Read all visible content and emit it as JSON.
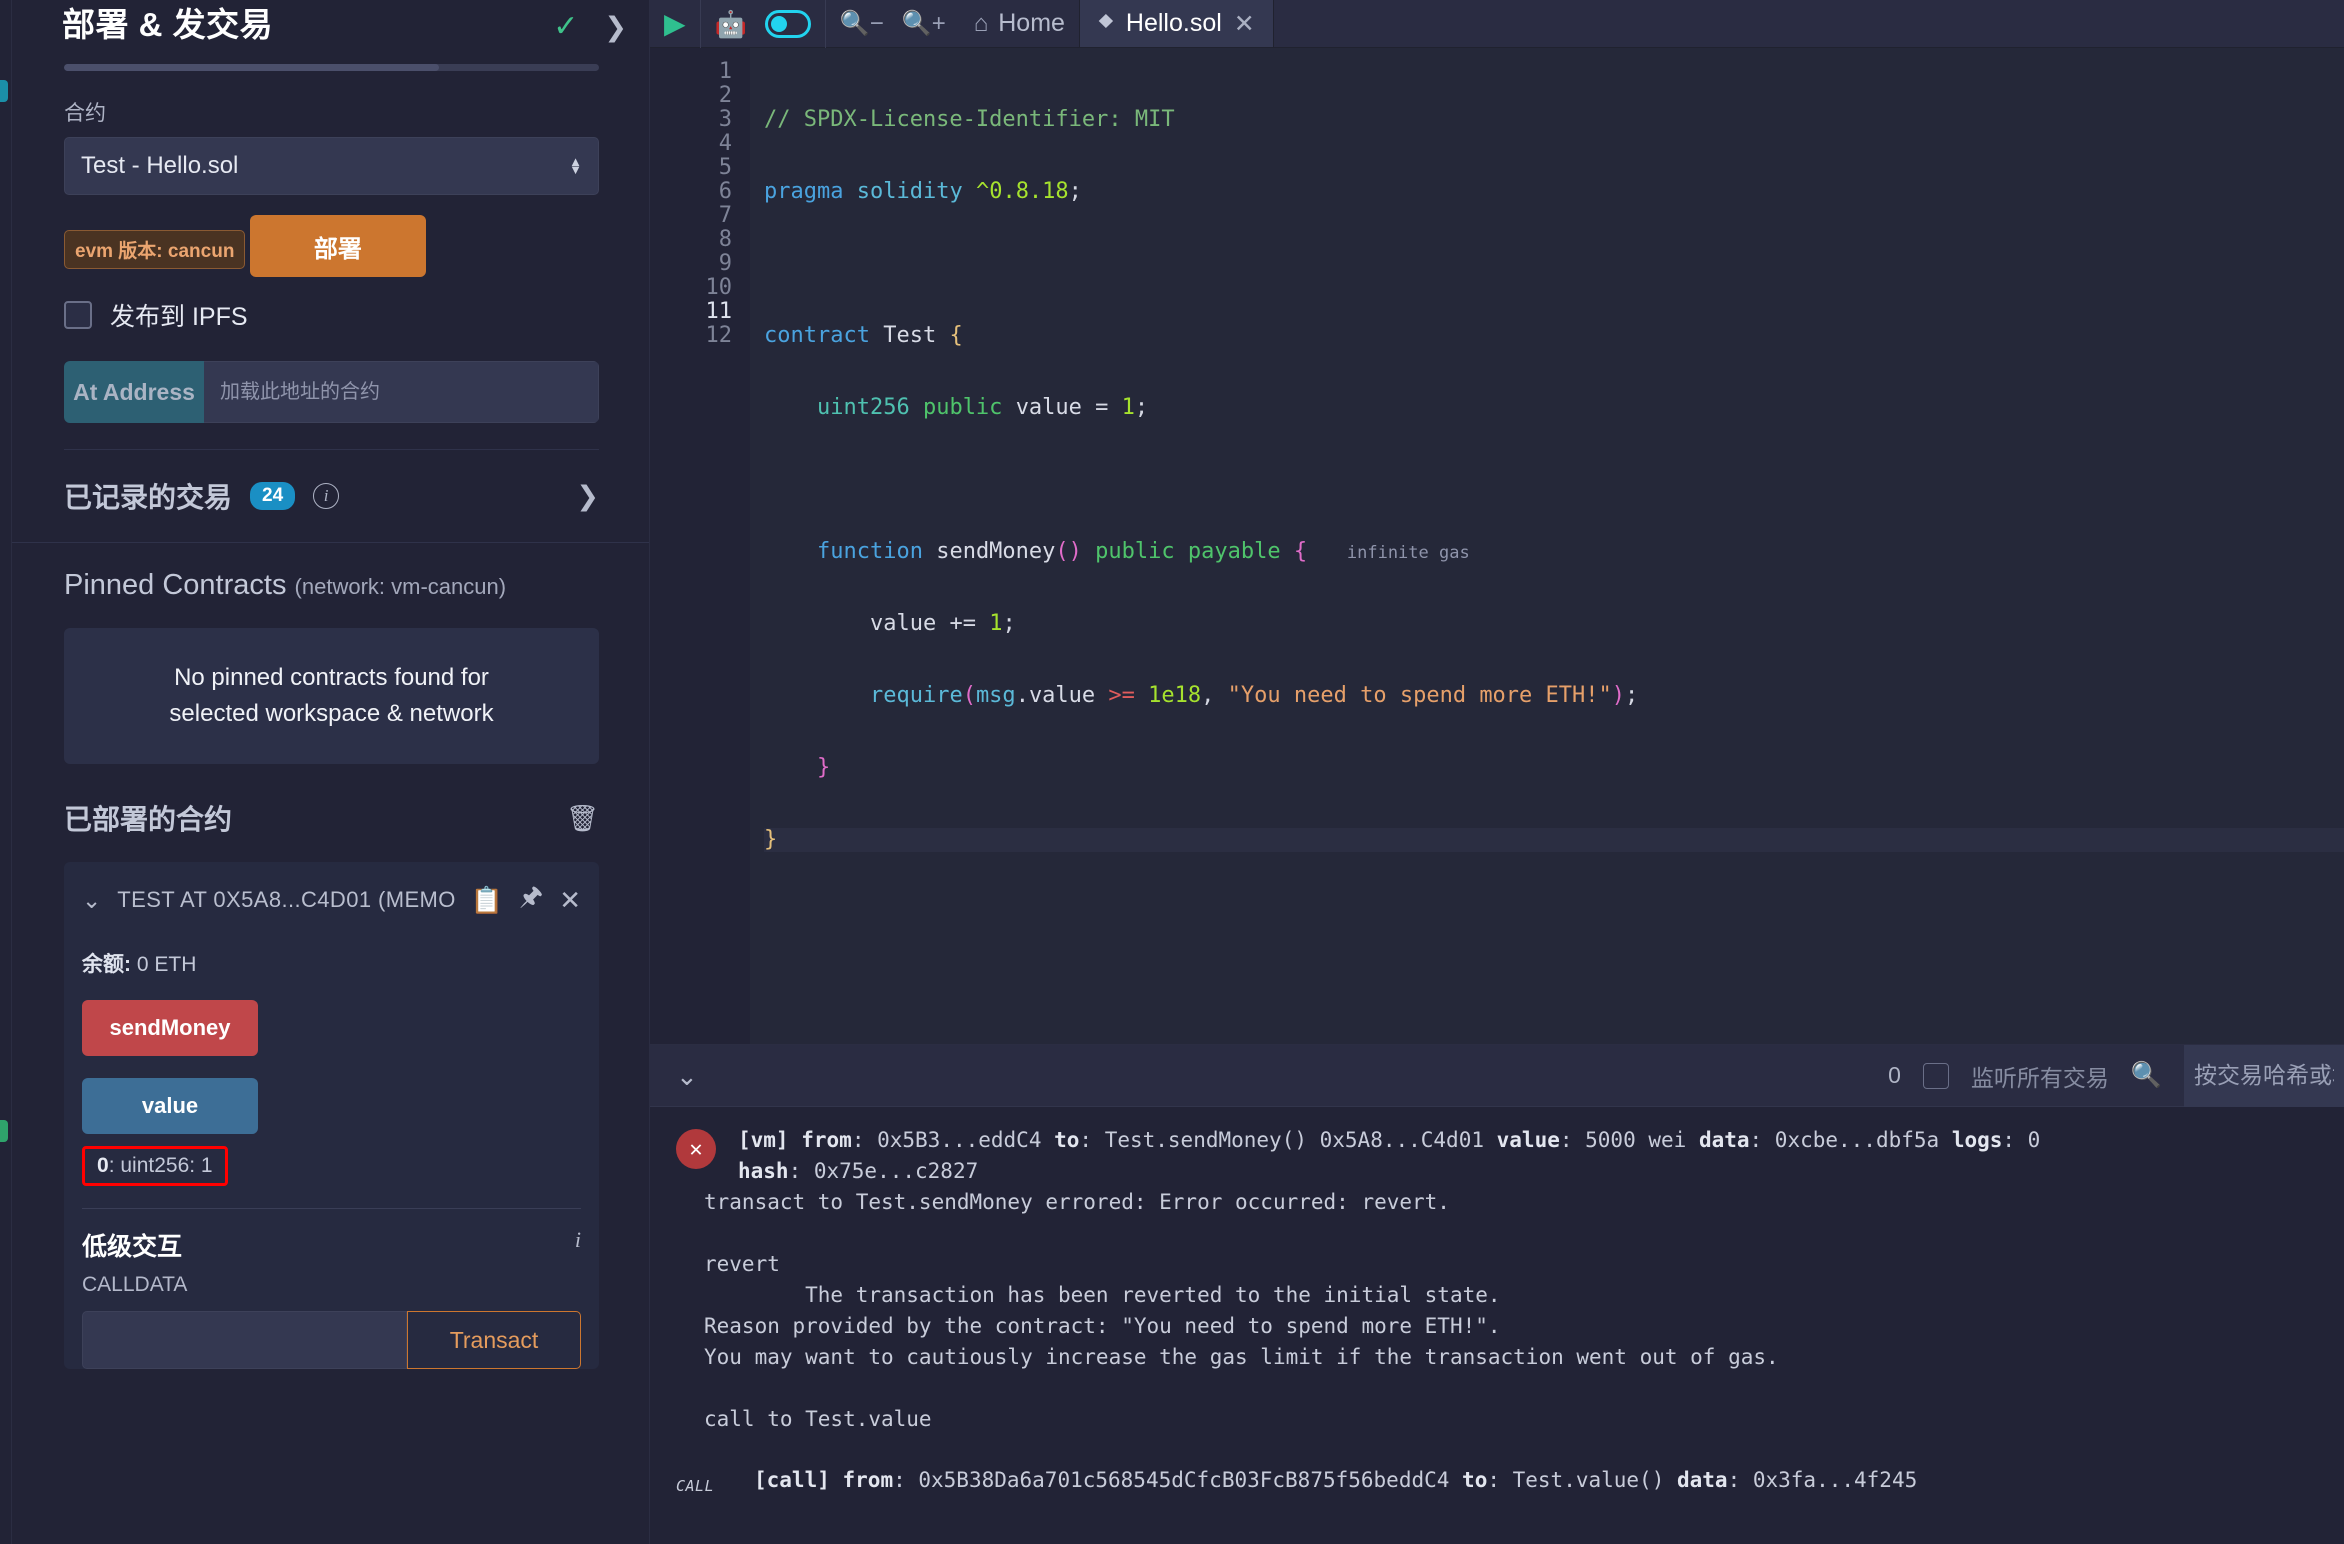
{
  "left_panel": {
    "title": "部署 & 发交易",
    "status_icon": "check-icon",
    "expand_icon": "chevron-right-icon",
    "contract_label": "合约",
    "contract_selected": "Test - Hello.sol",
    "evm_badge": "evm 版本: cancun",
    "deploy_button": "部署",
    "ipfs_label": "发布到 IPFS",
    "at_address_button": "At Address",
    "at_address_placeholder": "加载此地址的合约",
    "recorded_tx_title": "已记录的交易",
    "recorded_tx_count": "24",
    "pinned_title": "Pinned Contracts",
    "pinned_network": "(network: vm-cancun)",
    "pinned_empty_line1": "No pinned contracts found for",
    "pinned_empty_line2": "selected workspace & network",
    "deployed_title": "已部署的合约",
    "contract_card": {
      "name": "TEST AT 0X5A8...C4D01 (MEMO",
      "balance": "余额: 0 ETH",
      "balance_key": "余额:",
      "balance_val": "0 ETH",
      "fn_send": "sendMoney",
      "fn_value": "value",
      "result": "0: uint256: 1",
      "result_index": "0",
      "result_rest": ": uint256: 1",
      "lowlevel_title": "低级交互",
      "calldata_label": "CALLDATA",
      "calldata_value": "",
      "transact_button": "Transact"
    }
  },
  "toolbar": {
    "play_icon": "play-icon",
    "ai_icon": "robot-icon",
    "toggle_icon": "toggle-on-icon",
    "zoom_out_icon": "zoom-out-icon",
    "zoom_in_icon": "zoom-in-icon",
    "home_icon": "home-icon",
    "home_label": "Home",
    "tab_icon": "solidity-icon",
    "tab_label": "Hello.sol",
    "tab_close_icon": "close-icon"
  },
  "editor": {
    "line_numbers": [
      "1",
      "2",
      "3",
      "4",
      "5",
      "6",
      "7",
      "8",
      "9",
      "10",
      "11",
      "12"
    ],
    "current_line": 11,
    "gas_hint": "infinite gas",
    "lines": [
      "// SPDX-License-Identifier: MIT",
      "pragma solidity ^0.8.18;",
      "",
      "contract Test {",
      "    uint256 public value = 1;",
      "",
      "    function sendMoney() public payable {",
      "        value += 1;",
      "        require(msg.value >= 1e18, \"You need to spend more ETH!\");",
      "    }",
      "}",
      ""
    ]
  },
  "terminal": {
    "collapse_icon": "double-chevron-down-icon",
    "count": "0",
    "listen_label": "监听所有交易",
    "search_icon": "search-icon",
    "search_placeholder": "按交易哈希或地",
    "entries": [
      {
        "status": "error",
        "header_line1_parts": [
          "[vm] ",
          "from",
          ": 0x5B3...eddC4 ",
          "to",
          ": Test.sendMoney() 0x5A8...C4d01 ",
          "value",
          ": 5000 wei ",
          "data",
          ": 0xcbe...dbf5a ",
          "logs",
          ": 0"
        ],
        "header_line2": "hash: 0x75e...c2827",
        "body": [
          "transact to Test.sendMoney errored: Error occurred: revert.",
          "",
          "revert",
          "\tThe transaction has been reverted to the initial state.",
          "Reason provided by the contract: \"You need to spend more ETH!\".",
          "You may want to cautiously increase the gas limit if the transaction went out of gas.",
          "",
          "call to Test.value"
        ]
      },
      {
        "status": "call",
        "badge": "CALL",
        "header": "[call] from: 0x5B38Da6a701c568545dCfcB03FcB875f56beddC4 to: Test.value() data: 0x3fa...4f245"
      }
    ]
  },
  "colors": {
    "accent_orange": "#cc762f",
    "bg": "#222336",
    "panel": "#262a40",
    "badge_blue": "#1a8fc4",
    "error_red": "#b1393c",
    "highlight_red": "#ff0000",
    "success_green": "#3fc28a",
    "cyan": "#22d3ee"
  }
}
